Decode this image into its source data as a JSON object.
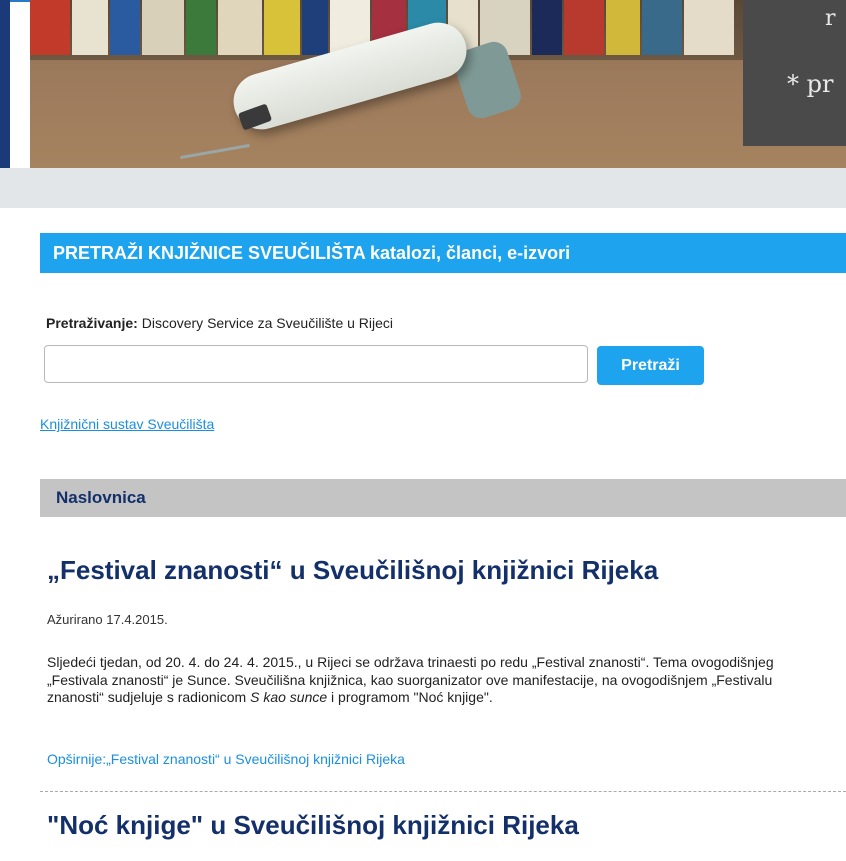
{
  "banner": {
    "text_top": "r",
    "text": "* pr"
  },
  "search": {
    "heading": "PRETRAŽI KNJIŽNICE SVEUČILIŠTA katalozi, članci, e-izvori",
    "label_bold": "Pretraživanje:",
    "label_rest": " Discovery Service za Sveučilište u Rijeci",
    "input_value": "",
    "input_placeholder": "",
    "button_label": "Pretraži",
    "library_link": "Knjižnični sustav Sveučilišta"
  },
  "section": {
    "title": "Naslovnica"
  },
  "articles": [
    {
      "title": "„Festival znanosti“ u Sveučilišnoj knjižnici Rijeka",
      "updated": "Ažurirano 17.4.2015.",
      "body_1": "Sljedeći tjedan, od  20. 4. do 24. 4. 2015., u Rijeci  se održava  trinaesti po redu „Festival znanosti“. Tema ovogodišnjeg „Festivala znanosti“ je Sunce.  Sveučilišna knjižnica, kao suorganizator ove manifestacije, na ovogodišnjem „Festivalu znanosti“ sudjeluje s radionicom ",
      "body_em": "S kao sunce",
      "body_2": "  i programom  \"Noć knjige\".",
      "more_link": "Opširnije:„Festival znanosti“ u Sveučilišnoj knjižnici Rijeka"
    },
    {
      "title": "\"Noć knjige\" u Sveučilišnoj knjižnici Rijeka"
    }
  ],
  "colors": {
    "accent_blue": "#1ea3ee",
    "title_navy": "#14306a",
    "section_gray": "#c4c4c4",
    "link_blue": "#1a8fe0"
  }
}
